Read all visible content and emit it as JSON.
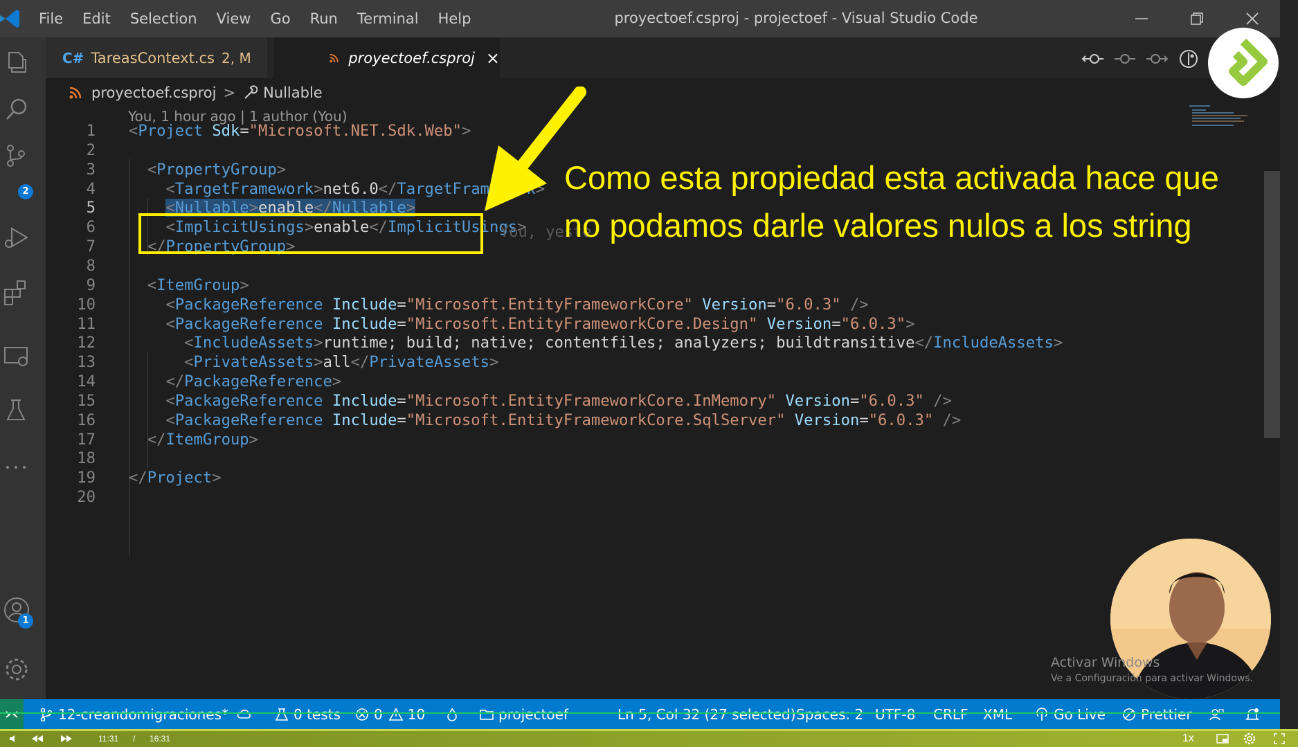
{
  "titlebar": {
    "menu": [
      "File",
      "Edit",
      "Selection",
      "View",
      "Go",
      "Run",
      "Terminal",
      "Help"
    ],
    "title": "proyectoef.csproj - projectoef - Visual Studio Code"
  },
  "activity_bar": {
    "icons": [
      "explorer-icon",
      "search-icon",
      "source-control-icon",
      "run-debug-icon",
      "extensions-icon",
      "remote-explorer-icon",
      "testing-icon",
      "more-icon",
      "accounts-icon",
      "settings-gear-icon"
    ],
    "source_control_badge": "2",
    "accounts_badge": "1"
  },
  "tabs": [
    {
      "label": "TareasContext.cs",
      "status": "2, M"
    },
    {
      "label": "proyectoef.csproj",
      "close": "×"
    }
  ],
  "breadcrumb": {
    "file": "proyectoef.csproj",
    "separator": ">",
    "symbol": "Nullable"
  },
  "codelens": "You, 1 hour ago | 1 author (You)",
  "editor": {
    "active_line": 5,
    "lines": [
      {
        "n": "1",
        "tokens": [
          [
            "p",
            "<"
          ],
          [
            "t",
            "Project"
          ],
          [
            "a",
            " Sdk"
          ],
          [
            "x",
            "="
          ],
          [
            "s",
            "\"Microsoft.NET.Sdk.Web\""
          ],
          [
            "p",
            ">"
          ]
        ]
      },
      {
        "n": "2",
        "tokens": []
      },
      {
        "n": "3",
        "tokens": [
          [
            "x",
            "  "
          ],
          [
            "p",
            "<"
          ],
          [
            "t",
            "PropertyGroup"
          ],
          [
            "p",
            ">"
          ]
        ]
      },
      {
        "n": "4",
        "tokens": [
          [
            "x",
            "    "
          ],
          [
            "p",
            "<"
          ],
          [
            "t",
            "TargetFramework"
          ],
          [
            "p",
            ">"
          ],
          [
            "x",
            "net6.0"
          ],
          [
            "p",
            "</"
          ],
          [
            "t",
            "TargetFramework"
          ],
          [
            "p",
            ">"
          ]
        ]
      },
      {
        "n": "5",
        "tokens": [
          [
            "x",
            "    "
          ],
          [
            "sp",
            "<"
          ],
          [
            "st",
            "Nullable"
          ],
          [
            "sp",
            ">"
          ],
          [
            "sx",
            "enable"
          ],
          [
            "sp",
            "</"
          ],
          [
            "st",
            "Nullable"
          ],
          [
            "sp",
            ">"
          ]
        ]
      },
      {
        "n": "6",
        "tokens": [
          [
            "x",
            "    "
          ],
          [
            "p",
            "<"
          ],
          [
            "t",
            "ImplicitUsings"
          ],
          [
            "p",
            ">"
          ],
          [
            "x",
            "enable"
          ],
          [
            "p",
            "</"
          ],
          [
            "t",
            "ImplicitUsings"
          ],
          [
            "p",
            ">"
          ]
        ]
      },
      {
        "n": "7",
        "tokens": [
          [
            "x",
            "  "
          ],
          [
            "p",
            "</"
          ],
          [
            "t",
            "PropertyGroup"
          ],
          [
            "p",
            ">"
          ]
        ]
      },
      {
        "n": "8",
        "tokens": []
      },
      {
        "n": "9",
        "tokens": [
          [
            "x",
            "  "
          ],
          [
            "p",
            "<"
          ],
          [
            "t",
            "ItemGroup"
          ],
          [
            "p",
            ">"
          ]
        ]
      },
      {
        "n": "10",
        "tokens": [
          [
            "x",
            "    "
          ],
          [
            "p",
            "<"
          ],
          [
            "t",
            "PackageReference"
          ],
          [
            "a",
            " Include"
          ],
          [
            "x",
            "="
          ],
          [
            "s",
            "\"Microsoft.EntityFrameworkCore\""
          ],
          [
            "a",
            " Version"
          ],
          [
            "x",
            "="
          ],
          [
            "s",
            "\"6.0.3\""
          ],
          [
            "p",
            " />"
          ]
        ]
      },
      {
        "n": "11",
        "tokens": [
          [
            "x",
            "    "
          ],
          [
            "p",
            "<"
          ],
          [
            "t",
            "PackageReference"
          ],
          [
            "a",
            " Include"
          ],
          [
            "x",
            "="
          ],
          [
            "s",
            "\"Microsoft.EntityFrameworkCore.Design\""
          ],
          [
            "a",
            " Version"
          ],
          [
            "x",
            "="
          ],
          [
            "s",
            "\"6.0.3\""
          ],
          [
            "p",
            ">"
          ]
        ]
      },
      {
        "n": "12",
        "tokens": [
          [
            "x",
            "      "
          ],
          [
            "p",
            "<"
          ],
          [
            "t",
            "IncludeAssets"
          ],
          [
            "p",
            ">"
          ],
          [
            "x",
            "runtime; build; native; contentfiles; analyzers; buildtransitive"
          ],
          [
            "p",
            "</"
          ],
          [
            "t",
            "IncludeAssets"
          ],
          [
            "p",
            ">"
          ]
        ]
      },
      {
        "n": "13",
        "tokens": [
          [
            "x",
            "      "
          ],
          [
            "p",
            "<"
          ],
          [
            "t",
            "PrivateAssets"
          ],
          [
            "p",
            ">"
          ],
          [
            "x",
            "all"
          ],
          [
            "p",
            "</"
          ],
          [
            "t",
            "PrivateAssets"
          ],
          [
            "p",
            ">"
          ]
        ]
      },
      {
        "n": "14",
        "tokens": [
          [
            "x",
            "    "
          ],
          [
            "p",
            "</"
          ],
          [
            "t",
            "PackageReference"
          ],
          [
            "p",
            ">"
          ]
        ]
      },
      {
        "n": "15",
        "tokens": [
          [
            "x",
            "    "
          ],
          [
            "p",
            "<"
          ],
          [
            "t",
            "PackageReference"
          ],
          [
            "a",
            " Include"
          ],
          [
            "x",
            "="
          ],
          [
            "s",
            "\"Microsoft.EntityFrameworkCore.InMemory\""
          ],
          [
            "a",
            " Version"
          ],
          [
            "x",
            "="
          ],
          [
            "s",
            "\"6.0.3\""
          ],
          [
            "p",
            " />"
          ]
        ]
      },
      {
        "n": "16",
        "tokens": [
          [
            "x",
            "    "
          ],
          [
            "p",
            "<"
          ],
          [
            "t",
            "PackageReference"
          ],
          [
            "a",
            " Include"
          ],
          [
            "x",
            "="
          ],
          [
            "s",
            "\"Microsoft.EntityFrameworkCore.SqlServer\""
          ],
          [
            "a",
            " Version"
          ],
          [
            "x",
            "="
          ],
          [
            "s",
            "\"6.0.3\""
          ],
          [
            "p",
            " />"
          ]
        ]
      },
      {
        "n": "17",
        "tokens": [
          [
            "x",
            "  "
          ],
          [
            "p",
            "</"
          ],
          [
            "t",
            "ItemGroup"
          ],
          [
            "p",
            ">"
          ]
        ]
      },
      {
        "n": "18",
        "tokens": []
      },
      {
        "n": "19",
        "tokens": [
          [
            "p",
            "</"
          ],
          [
            "t",
            "Project"
          ],
          [
            "p",
            ">"
          ]
        ]
      },
      {
        "n": "20",
        "tokens": []
      }
    ],
    "ghost_blame": "You, yeste"
  },
  "annotation": {
    "text": "Como esta propiedad esta activada hace que no podamos darle valores nulos a los string",
    "color": "#fff200"
  },
  "watermark": {
    "title": "Activar Windows",
    "subtitle": "Ve a Configuración para activar Windows."
  },
  "statusbar": {
    "branch": "12-creandomigraciones*",
    "tests": "0 tests",
    "errors": "0",
    "warnings": "10",
    "folder": "projectoef",
    "position": "Ln 5, Col 32 (27 selected)",
    "spaces": "Spaces: 2",
    "encoding": "UTF-8",
    "eol": "CRLF",
    "language": "XML",
    "go_live": "Go Live",
    "prettier": "Prettier",
    "accent": "#007acc"
  },
  "player": {
    "current_time": "11:31",
    "separator": "/",
    "duration": "16:31",
    "speed": "1x"
  }
}
